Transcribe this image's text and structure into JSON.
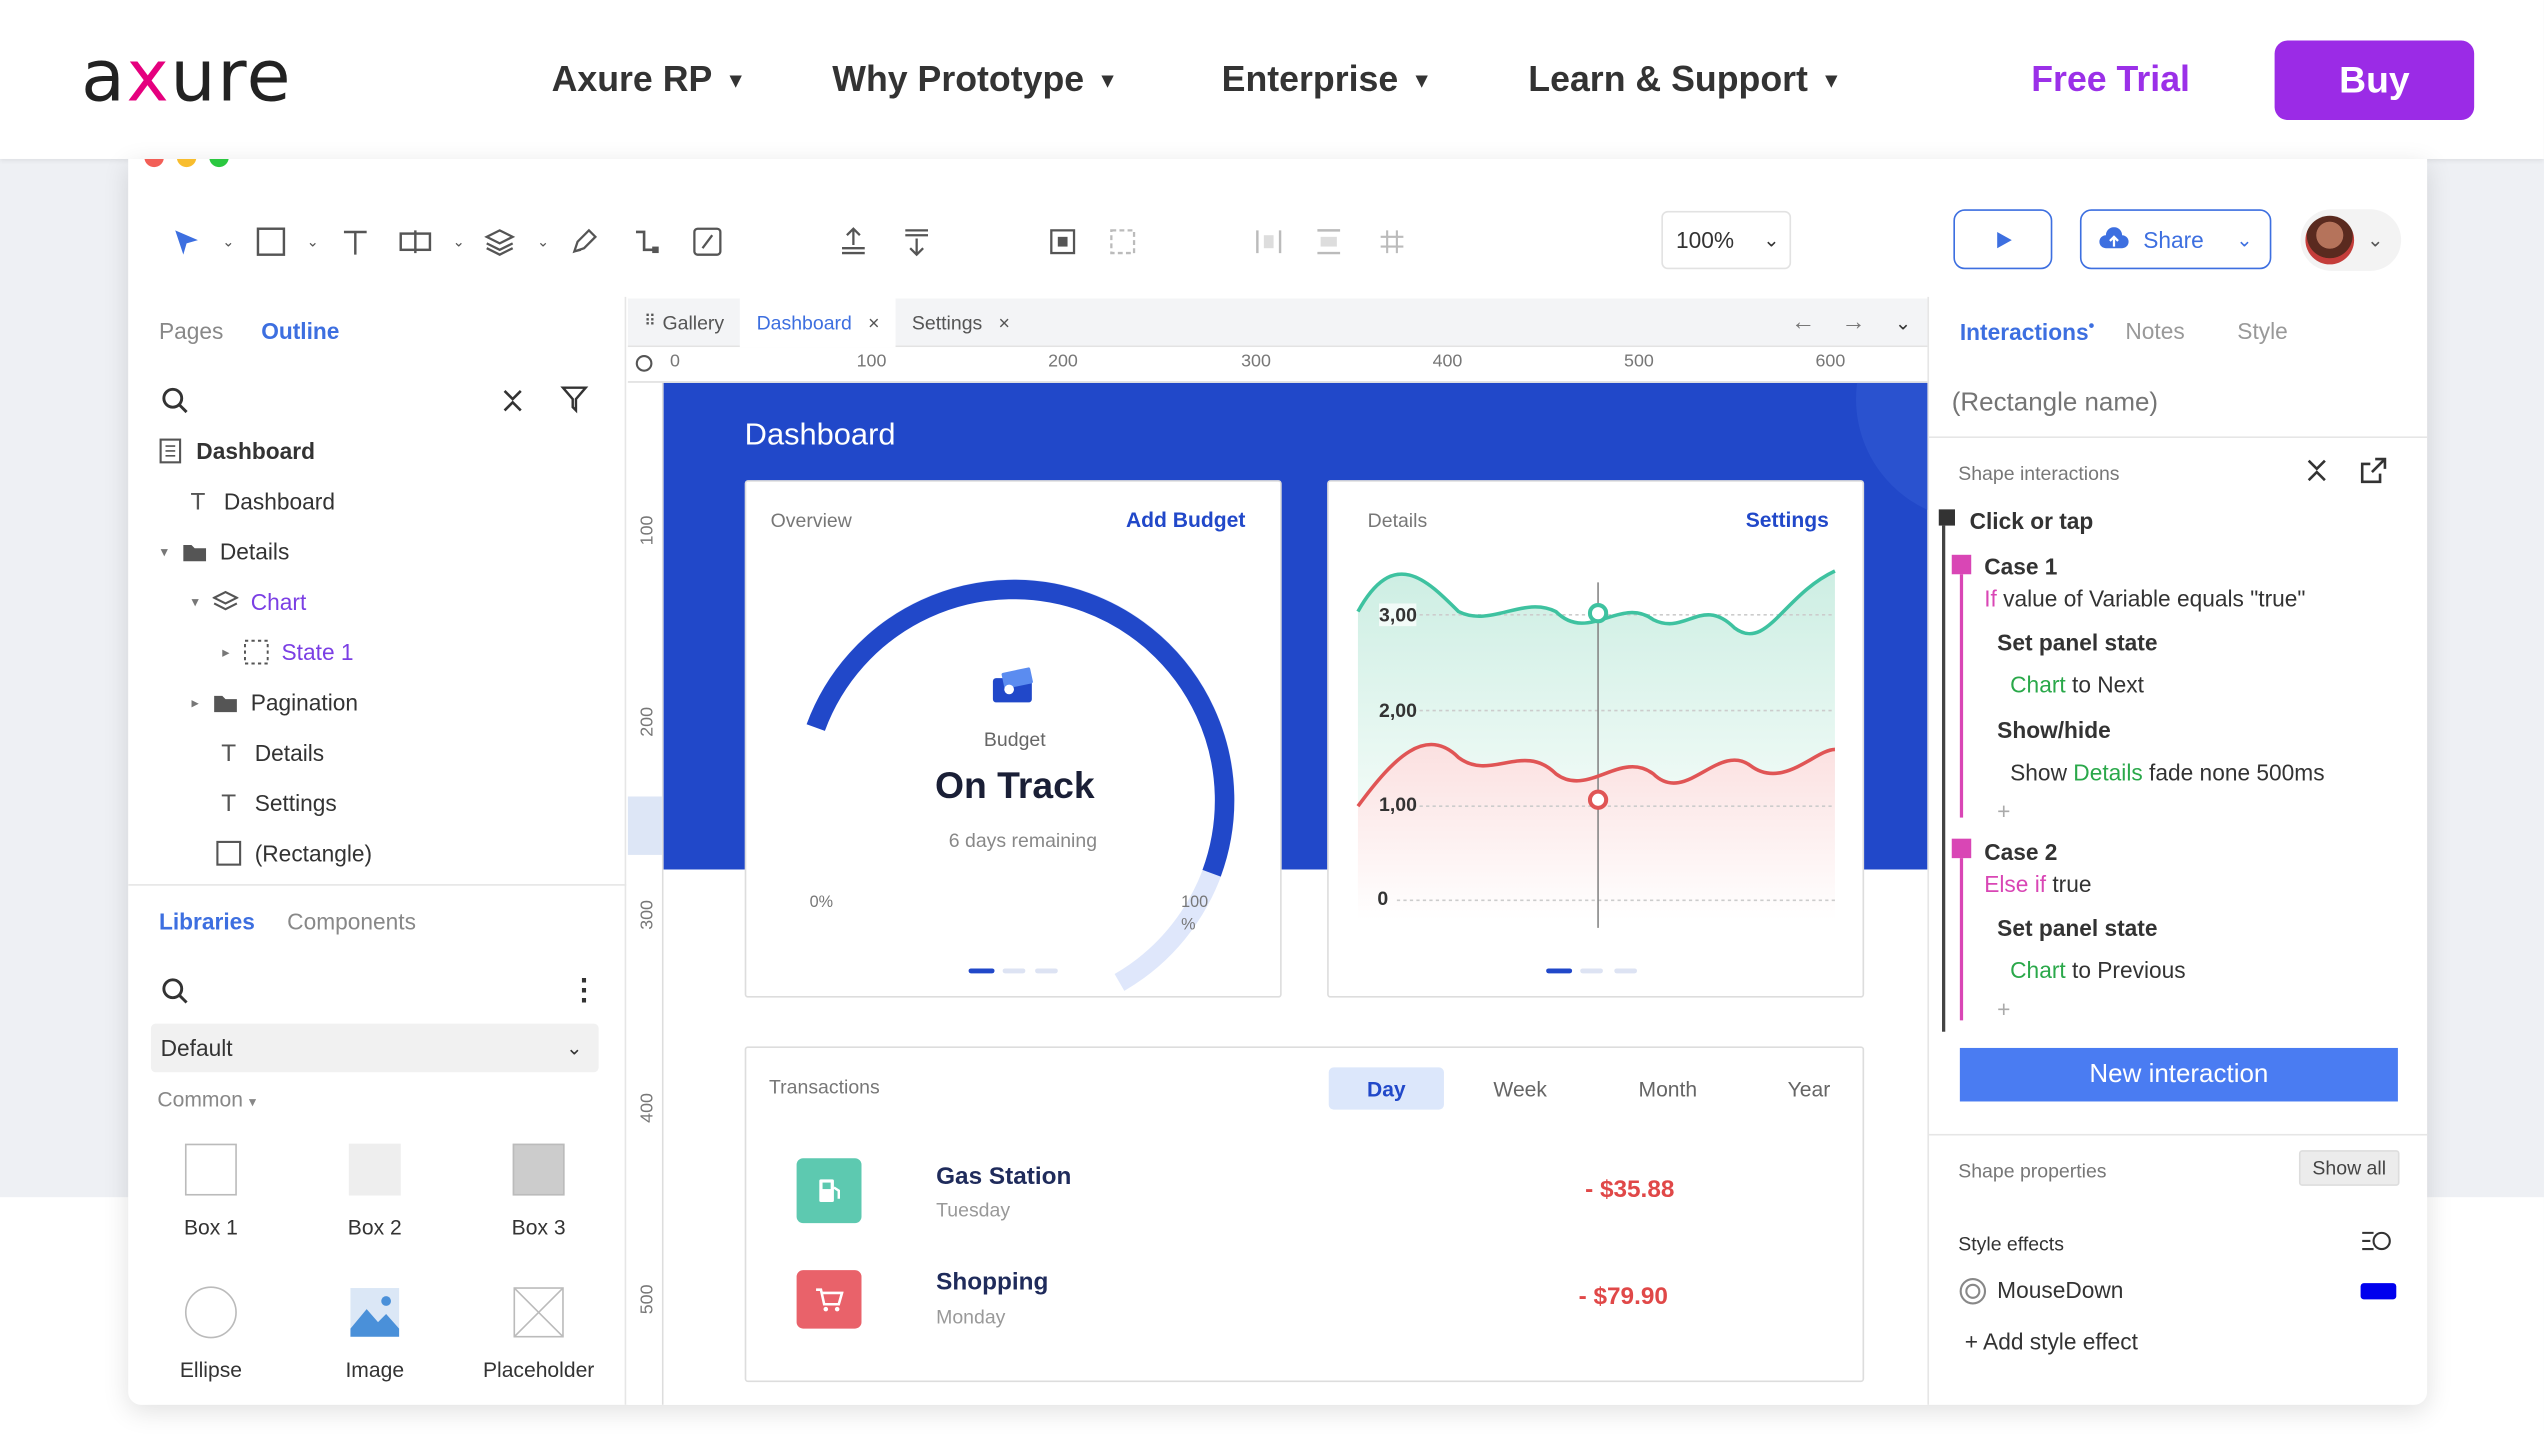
{
  "site": {
    "logo": "axure",
    "nav": [
      {
        "label": "Axure RP"
      },
      {
        "label": "Why Prototype"
      },
      {
        "label": "Enterprise"
      },
      {
        "label": "Learn & Support"
      }
    ],
    "free_trial": "Free Trial",
    "buy": "Buy",
    "caret": "▼"
  },
  "toolbar": {
    "zoom": "100%",
    "share": "Share"
  },
  "left_panel": {
    "tabs": [
      "Pages",
      "Outline"
    ],
    "tree": [
      {
        "label": "Dashboard"
      },
      {
        "label": "Dashboard"
      },
      {
        "label": "Details"
      },
      {
        "label": "Chart"
      },
      {
        "label": "State 1"
      },
      {
        "label": "Pagination"
      },
      {
        "label": "Details"
      },
      {
        "label": "Settings"
      },
      {
        "label": "(Rectangle)"
      }
    ],
    "lib_tabs": [
      "Libraries",
      "Components"
    ],
    "library_select": "Default",
    "section": "Common",
    "lib_items": [
      {
        "label": "Box 1"
      },
      {
        "label": "Box 2"
      },
      {
        "label": "Box 3"
      },
      {
        "label": "Ellipse"
      },
      {
        "label": "Image"
      },
      {
        "label": "Placeholder"
      }
    ]
  },
  "canvas": {
    "tabs": [
      {
        "label": "Gallery"
      },
      {
        "label": "Dashboard"
      },
      {
        "label": "Settings"
      }
    ],
    "ruler_top": [
      "0",
      "100",
      "200",
      "300",
      "400",
      "500",
      "600"
    ],
    "ruler_left": [
      "100",
      "200",
      "300",
      "400",
      "500"
    ],
    "dashboard_title": "Dashboard",
    "overview": {
      "label": "Overview",
      "link": "Add Budget",
      "budget_label": "Budget",
      "status": "On Track",
      "remaining": "6 days remaining",
      "min_label": "0%",
      "max_label": "100",
      "max_unit": "%",
      "progress": 0.82
    },
    "details": {
      "label": "Details",
      "link": "Settings",
      "y_ticks": [
        "3,00",
        "2,00",
        "1,00",
        "0"
      ]
    },
    "transactions": {
      "label": "Transactions",
      "ranges": [
        "Day",
        "Week",
        "Month",
        "Year"
      ],
      "rows": [
        {
          "name": "Gas Station",
          "day": "Tuesday",
          "amount": "- $35.88"
        },
        {
          "name": "Shopping",
          "day": "Monday",
          "amount": "- $79.90"
        }
      ]
    }
  },
  "right_panel": {
    "tabs": [
      "Interactions",
      "Notes",
      "Style"
    ],
    "name_placeholder": "(Rectangle name)",
    "shape_interactions": "Shape interactions",
    "event": "Click or tap",
    "case1": "Case 1",
    "case1_cond_kw": "If",
    "case1_cond": " value of Variable equals \"true\"",
    "set_panel_state": "Set panel state",
    "chart_word": "Chart",
    "to_next": " to Next",
    "show_hide": "Show/hide",
    "show_word": "Show ",
    "details_word": "Details",
    "fade": " fade none 500ms",
    "plus": "+",
    "case2": "Case 2",
    "case2_kw": "Else if",
    "case2_cond": " true",
    "set_panel_state2": "Set panel state",
    "to_previous": " to Previous",
    "new_interaction": "New interaction",
    "shape_properties": "Shape properties",
    "show_all": "Show all",
    "style_effects": "Style effects",
    "mousedown": "MouseDown",
    "add_style": "+ Add style effect",
    "mousedown_color": "#0000ee"
  }
}
